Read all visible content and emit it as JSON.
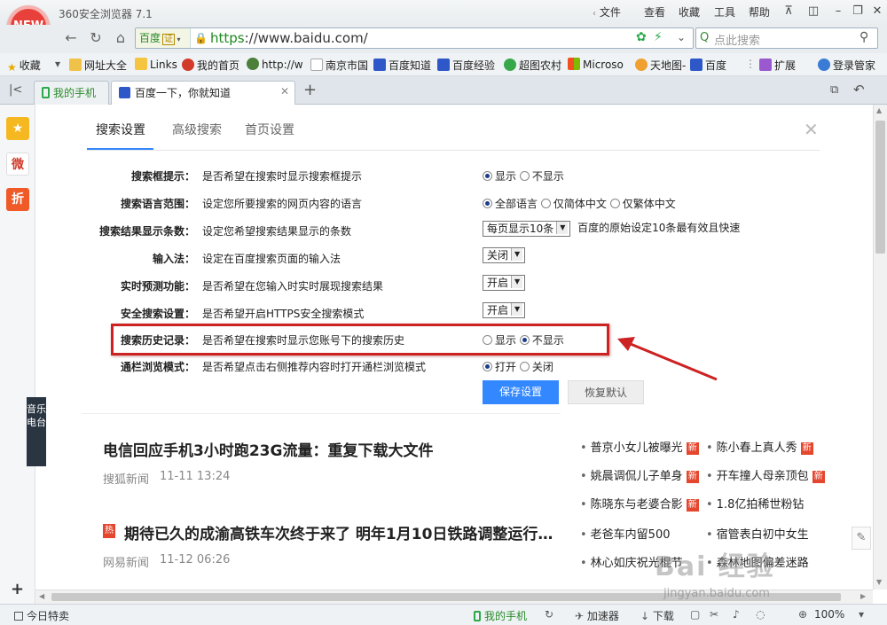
{
  "window": {
    "logo_text": "NEW",
    "title": "360安全浏览器 7.1",
    "menus": [
      "文件",
      "查看",
      "收藏",
      "工具",
      "帮助"
    ]
  },
  "address_bar": {
    "engine": "百度",
    "engine_badge": "证",
    "url_scheme": "https",
    "url_rest": "://www.baidu.com/",
    "search_placeholder": "点此搜索"
  },
  "bookmarks": [
    "收藏",
    "网址大全",
    "Links",
    "我的首页",
    "http://w",
    "南京市国",
    "百度知道",
    "百度经验",
    "超图农村",
    "Microso",
    "天地图-",
    "百度",
    "扩展",
    "登录管家"
  ],
  "tabs": [
    {
      "label": "我的手机"
    },
    {
      "label": "百度一下，你就知道"
    }
  ],
  "sidebar": {
    "items": [
      "★",
      "微",
      "折"
    ]
  },
  "settings": {
    "tabs": [
      "搜索设置",
      "高级搜索",
      "首页设置"
    ],
    "rows": [
      {
        "label": "搜索框提示：",
        "desc": "是否希望在搜索时显示搜索框提示",
        "options": [
          "显示",
          "不显示"
        ],
        "selected": "显示"
      },
      {
        "label": "搜索语言范围：",
        "desc": "设定您所要搜索的网页内容的语言",
        "options": [
          "全部语言",
          "仅简体中文",
          "仅繁体中文"
        ],
        "selected": "全部语言"
      },
      {
        "label": "搜索结果显示条数：",
        "desc": "设定您希望搜索结果显示的条数",
        "select": "每页显示10条",
        "note": "百度的原始设定10条最有效且快速"
      },
      {
        "label": "输入法：",
        "desc": "设定在百度搜索页面的输入法",
        "select": "关闭"
      },
      {
        "label": "实时预测功能：",
        "desc": "是否希望在您输入时实时展现搜索结果",
        "select": "开启"
      },
      {
        "label": "安全搜索设置：",
        "desc": "是否希望开启HTTPS安全搜索模式",
        "select": "开启"
      },
      {
        "label": "搜索历史记录：",
        "desc": "是否希望在搜索时显示您账号下的搜索历史",
        "options": [
          "显示",
          "不显示"
        ],
        "selected": "不显示"
      },
      {
        "label": "通栏浏览模式：",
        "desc": "是否希望点击右侧推荐内容时打开通栏浏览模式",
        "options": [
          "打开",
          "关闭"
        ],
        "selected": "打开"
      }
    ],
    "save_label": "保存设置",
    "reset_label": "恢复默认"
  },
  "news": {
    "radio_tag": "音乐电台",
    "items": [
      {
        "title": "电信回应手机3小时跑23G流量：重复下载大文件",
        "source": "搜狐新闻",
        "time": "11-11 13:24"
      },
      {
        "badge": "热",
        "title": "期待已久的成渝高铁车次终于来了 明年1月10日铁路调整运行…",
        "source": "网易新闻",
        "time": "11-12 06:26"
      }
    ],
    "hot_left": [
      "普京小女儿被曝光",
      "姚晨调侃儿子单身",
      "陈晓东与老婆合影",
      "老爸车内留500",
      "林心如庆祝光棍节"
    ],
    "hot_right": [
      "陈小春上真人秀",
      "开车撞人母亲顶包",
      "1.8亿拍稀世粉钻",
      "宿管表白初中女生",
      "森林地图偏差迷路"
    ],
    "new_badge": "新"
  },
  "status": {
    "left": "今日特卖",
    "phone": "我的手机",
    "accelerator": "加速器",
    "download": "下载",
    "zoom": "100%"
  },
  "watermark": "Bai 经验",
  "watermark_url": "jingyan.baidu.com",
  "colors": {
    "accent": "#3388ff",
    "highlight": "#cc2222",
    "new_badge": "#e4462e"
  }
}
